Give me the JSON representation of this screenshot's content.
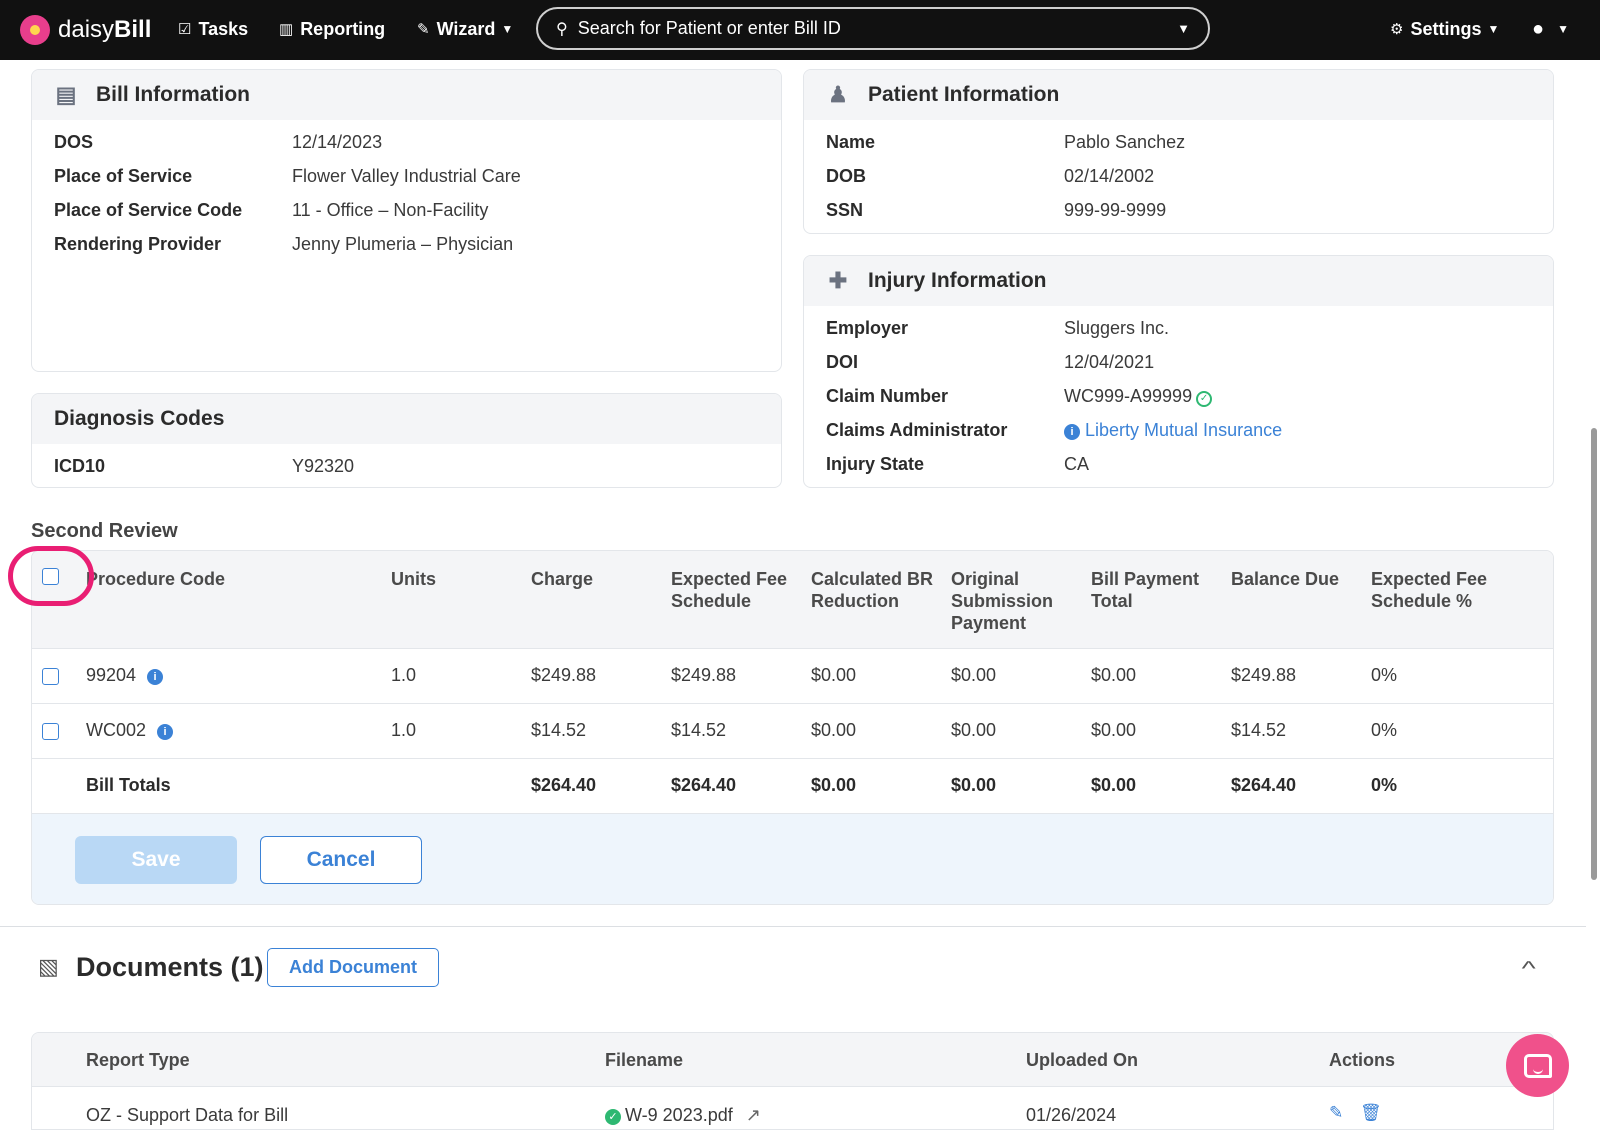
{
  "nav": {
    "logo_prefix": "daisy",
    "logo_suffix": "Bill",
    "tasks": "Tasks",
    "reporting": "Reporting",
    "wizard": "Wizard",
    "search_placeholder": "Search for Patient or enter Bill ID",
    "settings": "Settings"
  },
  "bill_info": {
    "title": "Bill Information",
    "rows": [
      {
        "label": "DOS",
        "value": "12/14/2023"
      },
      {
        "label": "Place of Service",
        "value": "Flower Valley Industrial Care"
      },
      {
        "label": "Place of Service Code",
        "value": "11 - Office – Non-Facility"
      },
      {
        "label": "Rendering Provider",
        "value": "Jenny Plumeria – Physician"
      }
    ]
  },
  "patient_info": {
    "title": "Patient Information",
    "rows": [
      {
        "label": "Name",
        "value": "Pablo Sanchez"
      },
      {
        "label": "DOB",
        "value": "02/14/2002"
      },
      {
        "label": "SSN",
        "value": "999-99-9999"
      }
    ]
  },
  "injury_info": {
    "title": "Injury Information",
    "rows": [
      {
        "label": "Employer",
        "value": "Sluggers Inc."
      },
      {
        "label": "DOI",
        "value": "12/04/2021"
      },
      {
        "label": "Claim Number",
        "value": "WC999-A99999"
      },
      {
        "label": "Claims Administrator",
        "value": "Liberty Mutual Insurance"
      },
      {
        "label": "Injury State",
        "value": "CA"
      }
    ]
  },
  "diagnosis": {
    "title": "Diagnosis Codes",
    "rows": [
      {
        "label": "ICD10",
        "value": "Y92320"
      }
    ]
  },
  "second_review": {
    "title": "Second Review",
    "headers": [
      "Procedure Code",
      "Units",
      "Charge",
      "Expected Fee Schedule",
      "Calculated BR Reduction",
      "Original Submission Payment",
      "Bill Payment Total",
      "Balance Due",
      "Expected Fee Schedule %"
    ],
    "rows": [
      {
        "code": "99204",
        "units": "1.0",
        "charge": "$249.88",
        "efs": "$249.88",
        "br": "$0.00",
        "osp": "$0.00",
        "bpt": "$0.00",
        "balance": "$249.88",
        "efs_pct": "0%"
      },
      {
        "code": "WC002",
        "units": "1.0",
        "charge": "$14.52",
        "efs": "$14.52",
        "br": "$0.00",
        "osp": "$0.00",
        "bpt": "$0.00",
        "balance": "$14.52",
        "efs_pct": "0%"
      }
    ],
    "totals": {
      "label": "Bill Totals",
      "charge": "$264.40",
      "efs": "$264.40",
      "br": "$0.00",
      "osp": "$0.00",
      "bpt": "$0.00",
      "balance": "$264.40",
      "efs_pct": "0%"
    },
    "save_label": "Save",
    "cancel_label": "Cancel"
  },
  "documents": {
    "title": "Documents (1)",
    "add_label": "Add Document",
    "headers": [
      "Report Type",
      "Filename",
      "Uploaded On",
      "Actions"
    ],
    "rows": [
      {
        "report_type": "OZ - Support Data for Bill",
        "filename": "W-9 2023.pdf",
        "uploaded_on": "01/26/2024"
      }
    ]
  },
  "colors": {
    "accent": "#3b82d6",
    "highlight": "#e91e73",
    "success": "#2eb872",
    "navbar": "#111111"
  }
}
